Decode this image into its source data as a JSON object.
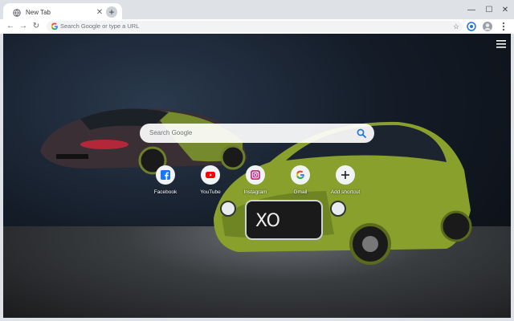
{
  "tab": {
    "title": "New Tab",
    "close_icon": "close-icon"
  },
  "toolbar": {
    "omnibox_placeholder": "Search Google or type a URL"
  },
  "search": {
    "placeholder": "Search Google"
  },
  "tiles": [
    {
      "label": "Facebook",
      "icon": "facebook-icon"
    },
    {
      "label": "YouTube",
      "icon": "youtube-icon"
    },
    {
      "label": "Instagram",
      "icon": "instagram-icon"
    },
    {
      "label": "Gmail",
      "icon": "google-icon"
    },
    {
      "label": "Add shortcut",
      "icon": "plus-icon"
    }
  ],
  "colors": {
    "car_green": "#8aa02c",
    "background_dark": "#0a0d12",
    "accent_blue": "#1a73e8"
  }
}
